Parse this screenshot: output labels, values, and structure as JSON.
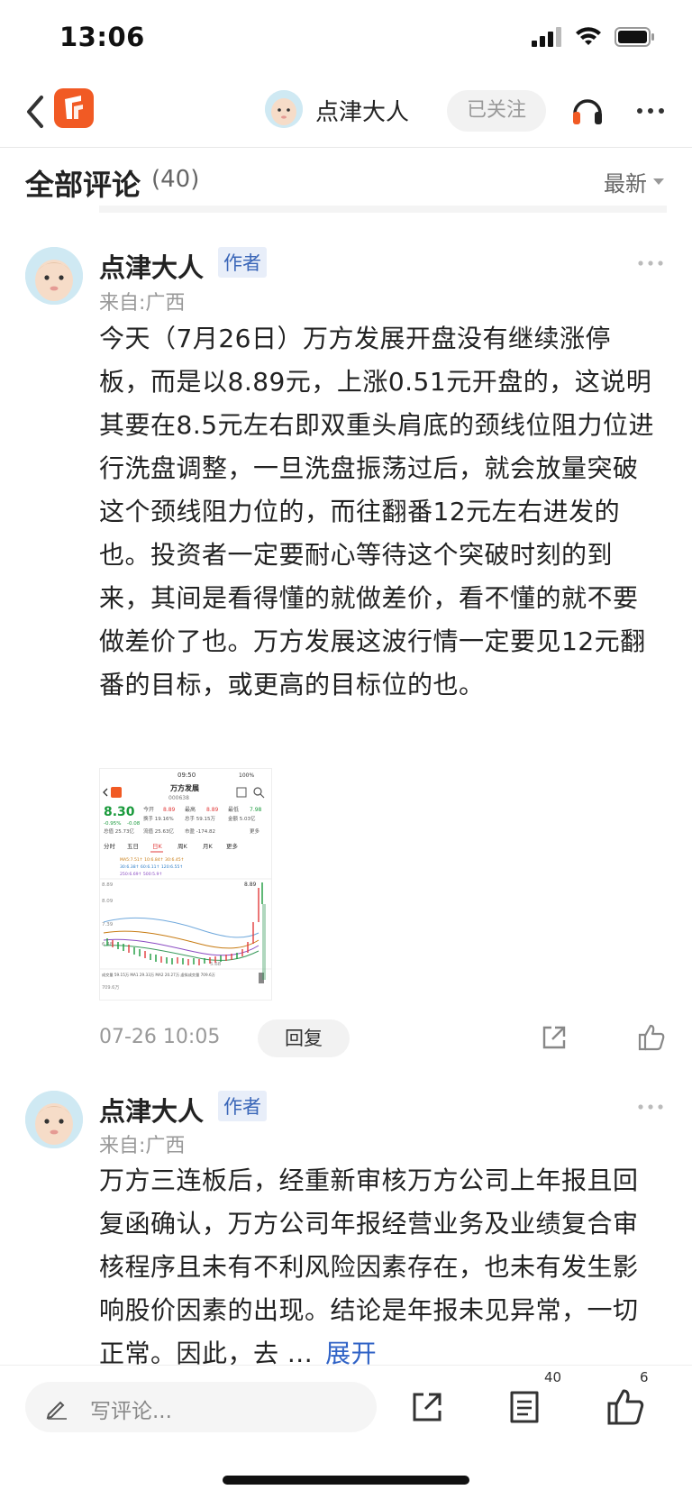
{
  "status_bar": {
    "time": "13:06"
  },
  "nav": {
    "username": "点津大人",
    "follow_label": "已关注"
  },
  "comments_header": {
    "title": "全部评论",
    "count": "(40)",
    "sort_label": "最新"
  },
  "comments": [
    {
      "author": "点津大人",
      "badge": "作者",
      "location": "来自:广西",
      "text": "今天（7月26日）万方发展开盘没有继续涨停板，而是以8.89元，上涨0.51元开盘的，这说明其要在8.5元左右即双重头肩底的颈线位阻力位进行洗盘调整，一旦洗盘振荡过后，就会放量突破这个颈线阻力位的，而往翻番12元左右进发的也。投资者一定要耐心等待这个突破时刻的到来，其间是看得懂的就做差价，看不懂的就不要做差价了也。万方发展这波行情一定要见12元翻番的目标，或更高的目标位的也。",
      "time": "07-26 10:05",
      "reply_label": "回复",
      "image": {
        "status_time": "09:50",
        "battery": "100%",
        "stock_name": "万方发展",
        "stock_code": "000638",
        "price": "8.30",
        "change": "-0.95%",
        "change_abs": "-0.08",
        "open_label": "今开",
        "open": "8.89",
        "high_label": "最高",
        "high": "8.89",
        "low_label": "最低",
        "low": "7.98",
        "turnover": "换手 19.16%",
        "total_hand": "总手 59.15万",
        "amount": "金额 5.03亿",
        "total_cap": "总值 25.73亿",
        "float_cap": "流值 25.63亿",
        "pe": "市盈 -174.82",
        "more_label": "更多",
        "tabs": [
          "分时",
          "五日",
          "日K",
          "周K",
          "月K",
          "更多"
        ],
        "ma_line": "MA5:7.51↑ 10:6.84↑ 30:6.45↑",
        "ma_line2": "30:6.38↑ 60:6.11↑ 120:6.55↑",
        "ma_line3": "250:6.69↑ 500:5.9↑",
        "y_labels": [
          "8.89",
          "8.09",
          "7.39",
          "6.48",
          "5.68"
        ],
        "top_value": "8.89",
        "vol_line": "成交量 59.15万 MA1 29.33万 MA2 20.27万 虚拟成交量 709.6万",
        "vol_bottom": "709.6万"
      }
    },
    {
      "author": "点津大人",
      "badge": "作者",
      "location": "来自:广西",
      "text": "万方三连板后，经重新审核万方公司上年报且回复函确认，万方公司年报经营业务及业绩复合审核程序且未有不利风险因素存在，也未有发生影响股价因素的出现。结论是年报未见异常，一切正常。因此，去 ...",
      "expand_label": "展开"
    }
  ],
  "bottom_bar": {
    "placeholder": "写评论...",
    "comment_count": "40",
    "like_count": "6"
  },
  "colors": {
    "accent_blue": "#2f62c6",
    "brand_orange": "#f15a24",
    "red": "#e23b3b",
    "green": "#1a9a3c"
  }
}
